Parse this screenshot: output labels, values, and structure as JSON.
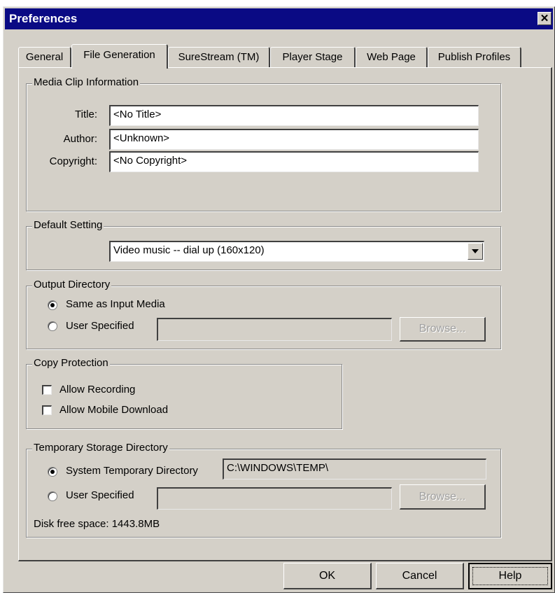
{
  "window": {
    "title": "Preferences"
  },
  "tabs": [
    {
      "label": "General"
    },
    {
      "label": "File Generation"
    },
    {
      "label": "SureStream (TM)"
    },
    {
      "label": "Player Stage"
    },
    {
      "label": "Web Page"
    },
    {
      "label": "Publish Profiles"
    }
  ],
  "media_clip": {
    "legend": "Media Clip Information",
    "title_label": "Title:",
    "title_value": "<No Title>",
    "author_label": "Author:",
    "author_value": "<Unknown>",
    "copyright_label": "Copyright:",
    "copyright_value": "<No Copyright>"
  },
  "default_setting": {
    "legend": "Default Setting",
    "selected": "Video music --  dial up (160x120)"
  },
  "output_directory": {
    "legend": "Output Directory",
    "option_same": "Same as Input Media",
    "option_user": "User Specified",
    "user_path": "",
    "browse_label": "Browse...",
    "selected": "Same as Input Media"
  },
  "copy_protection": {
    "legend": "Copy Protection",
    "allow_recording": "Allow Recording",
    "allow_recording_checked": false,
    "allow_mobile": "Allow Mobile Download",
    "allow_mobile_checked": false
  },
  "temp_storage": {
    "legend": "Temporary Storage Directory",
    "option_system": "System Temporary Directory",
    "system_path": "C:\\WINDOWS\\TEMP\\",
    "option_user": "User Specified",
    "user_path": "",
    "browse_label": "Browse...",
    "disk_free": "Disk free space: 1443.8MB",
    "selected": "System Temporary Directory"
  },
  "buttons": {
    "ok": "OK",
    "cancel": "Cancel",
    "help": "Help"
  }
}
